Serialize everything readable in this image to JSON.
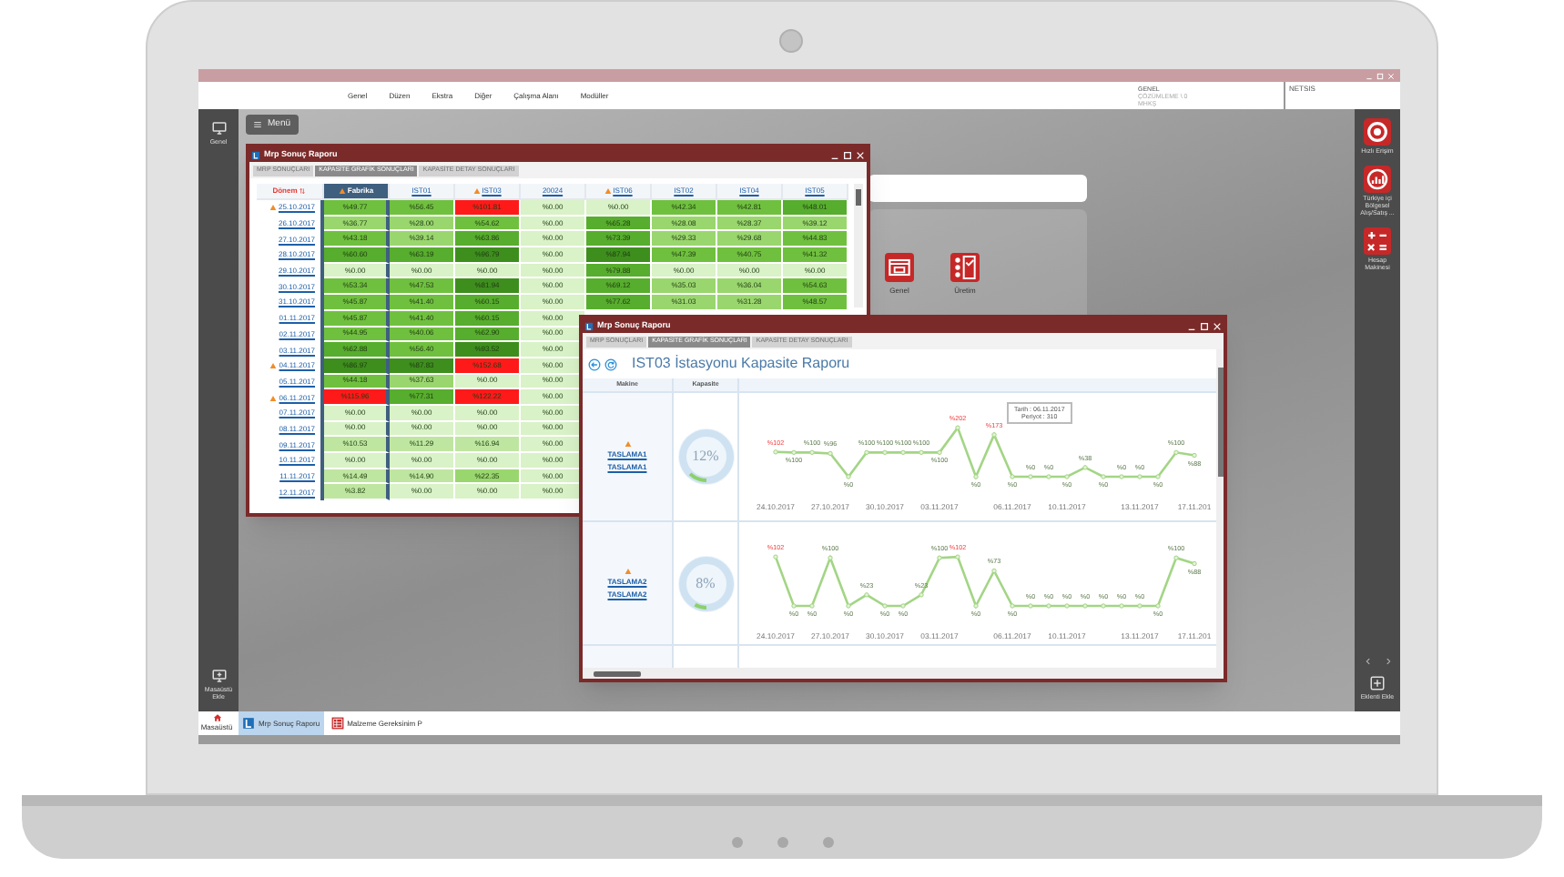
{
  "top_menu": {
    "items": [
      "Genel",
      "Düzen",
      "Ekstra",
      "Diğer",
      "Çalışma Alanı",
      "Modüller"
    ],
    "context": [
      "GENEL",
      "ÇÖZÜMLEME \\ 0",
      "MHKŞ"
    ],
    "product": "NETSIS"
  },
  "left_sidebar": {
    "top": "Genel",
    "bottom": "Masaüstü Ekle"
  },
  "right_sidebar": {
    "items": [
      {
        "kind": "target",
        "label": "Hızlı Erişim"
      },
      {
        "kind": "chart",
        "label": "Türkiye içi Bölgesel Alış/Satış ..."
      },
      {
        "kind": "calculator",
        "label": "Hesap Makinesi"
      }
    ],
    "add": "Eklenti Ekle"
  },
  "desktop": {
    "menu_button": "Menü",
    "shortcuts": [
      {
        "kind": "window",
        "label": "Genel"
      },
      {
        "kind": "checklist",
        "label": "Üretim"
      }
    ]
  },
  "report_window": {
    "title": "Mrp Sonuç Raporu",
    "tabs": [
      {
        "label": "MRP SONUÇLARI",
        "selected": false
      },
      {
        "label": "KAPASİTE GRAFİK SONUÇLARI",
        "selected": true
      },
      {
        "label": "KAPASİTE DETAY SONUÇLARI",
        "selected": false
      }
    ],
    "columns": [
      {
        "label": "Dönem",
        "sorted": true,
        "selected": false,
        "warning": false
      },
      {
        "label": "Fabrika",
        "sorted": false,
        "selected": true,
        "warning": true
      },
      {
        "label": "IST01",
        "sorted": false,
        "selected": false,
        "warning": false
      },
      {
        "label": "IST03",
        "sorted": false,
        "selected": false,
        "warning": true
      },
      {
        "label": "20024",
        "sorted": false,
        "selected": false,
        "warning": false
      },
      {
        "label": "IST06",
        "sorted": false,
        "selected": false,
        "warning": true
      },
      {
        "label": "IST02",
        "sorted": false,
        "selected": false,
        "warning": false
      },
      {
        "label": "IST04",
        "sorted": false,
        "selected": false,
        "warning": false
      },
      {
        "label": "IST05",
        "sorted": false,
        "selected": false,
        "warning": false
      }
    ],
    "rows": [
      {
        "warning": true,
        "cells": [
          {
            "text": "25.10.2017"
          },
          {
            "text": "%49.77",
            "color": "#70c03f"
          },
          {
            "text": "%56.45",
            "color": "#70c03f"
          },
          {
            "text": "%101.81",
            "color": "#ff1a1a"
          },
          {
            "text": "%0.00",
            "color": "#d9f2c7"
          },
          {
            "text": "%0.00",
            "color": "#d9f2c7"
          },
          {
            "text": "%42.34",
            "color": "#70c03f"
          },
          {
            "text": "%42.81",
            "color": "#70c03f"
          },
          {
            "text": "%48.01",
            "color": "#57ad2d"
          }
        ]
      },
      {
        "warning": false,
        "cells": [
          {
            "text": "26.10.2017"
          },
          {
            "text": "%36.77",
            "color": "#9ad66e"
          },
          {
            "text": "%28.00",
            "color": "#9ad66e"
          },
          {
            "text": "%54.62",
            "color": "#70c03f"
          },
          {
            "text": "%0.00",
            "color": "#d9f2c7"
          },
          {
            "text": "%65.28",
            "color": "#57ad2d"
          },
          {
            "text": "%28.08",
            "color": "#9ad66e"
          },
          {
            "text": "%28.37",
            "color": "#9ad66e"
          },
          {
            "text": "%39.12",
            "color": "#9ad66e"
          }
        ]
      },
      {
        "warning": false,
        "cells": [
          {
            "text": "27.10.2017"
          },
          {
            "text": "%43.18",
            "color": "#70c03f"
          },
          {
            "text": "%39.14",
            "color": "#9ad66e"
          },
          {
            "text": "%63.86",
            "color": "#57ad2d"
          },
          {
            "text": "%0.00",
            "color": "#d9f2c7"
          },
          {
            "text": "%73.39",
            "color": "#57ad2d"
          },
          {
            "text": "%29.33",
            "color": "#9ad66e"
          },
          {
            "text": "%29.68",
            "color": "#9ad66e"
          },
          {
            "text": "%44.83",
            "color": "#70c03f"
          }
        ]
      },
      {
        "warning": false,
        "cells": [
          {
            "text": "28.10.2017"
          },
          {
            "text": "%60.60",
            "color": "#57ad2d"
          },
          {
            "text": "%63.19",
            "color": "#57ad2d"
          },
          {
            "text": "%96.79",
            "color": "#3e8e1e"
          },
          {
            "text": "%0.00",
            "color": "#d9f2c7"
          },
          {
            "text": "%87.94",
            "color": "#3e8e1e"
          },
          {
            "text": "%47.39",
            "color": "#70c03f"
          },
          {
            "text": "%40.75",
            "color": "#70c03f"
          },
          {
            "text": "%41.32",
            "color": "#70c03f"
          }
        ]
      },
      {
        "warning": false,
        "cells": [
          {
            "text": "29.10.2017"
          },
          {
            "text": "%0.00",
            "color": "#d9f2c7"
          },
          {
            "text": "%0.00",
            "color": "#d9f2c7"
          },
          {
            "text": "%0.00",
            "color": "#d9f2c7"
          },
          {
            "text": "%0.00",
            "color": "#d9f2c7"
          },
          {
            "text": "%79.88",
            "color": "#57ad2d"
          },
          {
            "text": "%0.00",
            "color": "#d9f2c7"
          },
          {
            "text": "%0.00",
            "color": "#d9f2c7"
          },
          {
            "text": "%0.00",
            "color": "#d9f2c7"
          }
        ]
      },
      {
        "warning": false,
        "cells": [
          {
            "text": "30.10.2017"
          },
          {
            "text": "%53.34",
            "color": "#70c03f"
          },
          {
            "text": "%47.53",
            "color": "#70c03f"
          },
          {
            "text": "%81.94",
            "color": "#3e8e1e"
          },
          {
            "text": "%0.00",
            "color": "#d9f2c7"
          },
          {
            "text": "%69.12",
            "color": "#57ad2d"
          },
          {
            "text": "%35.03",
            "color": "#9ad66e"
          },
          {
            "text": "%36.04",
            "color": "#9ad66e"
          },
          {
            "text": "%54.63",
            "color": "#70c03f"
          }
        ]
      },
      {
        "warning": false,
        "cells": [
          {
            "text": "31.10.2017"
          },
          {
            "text": "%45.87",
            "color": "#70c03f"
          },
          {
            "text": "%41.40",
            "color": "#70c03f"
          },
          {
            "text": "%60.15",
            "color": "#57ad2d"
          },
          {
            "text": "%0.00",
            "color": "#d9f2c7"
          },
          {
            "text": "%77.62",
            "color": "#57ad2d"
          },
          {
            "text": "%31.03",
            "color": "#9ad66e"
          },
          {
            "text": "%31.28",
            "color": "#9ad66e"
          },
          {
            "text": "%48.57",
            "color": "#70c03f"
          }
        ]
      },
      {
        "warning": false,
        "cells": [
          {
            "text": "01.11.2017"
          },
          {
            "text": "%45.87",
            "color": "#70c03f"
          },
          {
            "text": "%41.40",
            "color": "#70c03f"
          },
          {
            "text": "%60.15",
            "color": "#57ad2d"
          },
          {
            "text": "%0.00",
            "color": "#d9f2c7"
          }
        ]
      },
      {
        "warning": false,
        "cells": [
          {
            "text": "02.11.2017"
          },
          {
            "text": "%44.95",
            "color": "#70c03f"
          },
          {
            "text": "%40.06",
            "color": "#70c03f"
          },
          {
            "text": "%62.90",
            "color": "#57ad2d"
          },
          {
            "text": "%0.00",
            "color": "#d9f2c7"
          }
        ]
      },
      {
        "warning": false,
        "cells": [
          {
            "text": "03.11.2017"
          },
          {
            "text": "%62.88",
            "color": "#57ad2d"
          },
          {
            "text": "%56.40",
            "color": "#70c03f"
          },
          {
            "text": "%93.52",
            "color": "#3e8e1e"
          },
          {
            "text": "%0.00",
            "color": "#d9f2c7"
          }
        ]
      },
      {
        "warning": true,
        "cells": [
          {
            "text": "04.11.2017"
          },
          {
            "text": "%86.97",
            "color": "#3e8e1e"
          },
          {
            "text": "%87.83",
            "color": "#3e8e1e"
          },
          {
            "text": "%152.68",
            "color": "#ff1a1a"
          },
          {
            "text": "%0.00",
            "color": "#d9f2c7"
          }
        ]
      },
      {
        "warning": false,
        "cells": [
          {
            "text": "05.11.2017"
          },
          {
            "text": "%44.18",
            "color": "#70c03f"
          },
          {
            "text": "%37.63",
            "color": "#9ad66e"
          },
          {
            "text": "%0.00",
            "color": "#d9f2c7"
          },
          {
            "text": "%0.00",
            "color": "#d9f2c7"
          }
        ]
      },
      {
        "warning": true,
        "cells": [
          {
            "text": "06.11.2017"
          },
          {
            "text": "%115.96",
            "color": "#ff1a1a"
          },
          {
            "text": "%77.31",
            "color": "#57ad2d"
          },
          {
            "text": "%122.22",
            "color": "#ff1a1a"
          },
          {
            "text": "%0.00",
            "color": "#d9f2c7"
          }
        ]
      },
      {
        "warning": false,
        "cells": [
          {
            "text": "07.11.2017"
          },
          {
            "text": "%0.00",
            "color": "#d9f2c7"
          },
          {
            "text": "%0.00",
            "color": "#d9f2c7"
          },
          {
            "text": "%0.00",
            "color": "#d9f2c7"
          },
          {
            "text": "%0.00",
            "color": "#d9f2c7"
          }
        ]
      },
      {
        "warning": false,
        "cells": [
          {
            "text": "08.11.2017"
          },
          {
            "text": "%0.00",
            "color": "#d9f2c7"
          },
          {
            "text": "%0.00",
            "color": "#d9f2c7"
          },
          {
            "text": "%0.00",
            "color": "#d9f2c7"
          },
          {
            "text": "%0.00",
            "color": "#d9f2c7"
          }
        ]
      },
      {
        "warning": false,
        "cells": [
          {
            "text": "09.11.2017"
          },
          {
            "text": "%10.53",
            "color": "#bfe6a0"
          },
          {
            "text": "%11.29",
            "color": "#bfe6a0"
          },
          {
            "text": "%16.94",
            "color": "#bfe6a0"
          },
          {
            "text": "%0.00",
            "color": "#d9f2c7"
          }
        ]
      },
      {
        "warning": false,
        "cells": [
          {
            "text": "10.11.2017"
          },
          {
            "text": "%0.00",
            "color": "#d9f2c7"
          },
          {
            "text": "%0.00",
            "color": "#d9f2c7"
          },
          {
            "text": "%0.00",
            "color": "#d9f2c7"
          },
          {
            "text": "%0.00",
            "color": "#d9f2c7"
          }
        ]
      },
      {
        "warning": false,
        "cells": [
          {
            "text": "11.11.2017"
          },
          {
            "text": "%14.49",
            "color": "#bfe6a0"
          },
          {
            "text": "%14.90",
            "color": "#bfe6a0"
          },
          {
            "text": "%22.35",
            "color": "#9ad66e"
          },
          {
            "text": "%0.00",
            "color": "#d9f2c7"
          }
        ]
      },
      {
        "warning": false,
        "cells": [
          {
            "text": "12.11.2017"
          },
          {
            "text": "%3.82",
            "color": "#bfe6a0"
          },
          {
            "text": "%0.00",
            "color": "#d9f2c7"
          },
          {
            "text": "%0.00",
            "color": "#d9f2c7"
          },
          {
            "text": "%0.00",
            "color": "#d9f2c7"
          }
        ]
      }
    ]
  },
  "capacity_window": {
    "title": "Mrp Sonuç Raporu",
    "tabs": [
      {
        "label": "MRP SONUÇLARI",
        "selected": false
      },
      {
        "label": "KAPASİTE GRAFİK SONUÇLARI",
        "selected": true
      },
      {
        "label": "KAPASİTE DETAY SONUÇLARI",
        "selected": false
      }
    ],
    "heading": "IST03 İstasyonu Kapasite Raporu",
    "columns": [
      "Makine",
      "Kapasite"
    ],
    "rows": [
      {
        "machine": [
          "TASLAMA1",
          "TASLAMA1"
        ],
        "warning": true,
        "capacity": {
          "text": "12%",
          "level": 0.12
        },
        "tooltip": [
          "Tarih : 06.11.2017",
          "Periyot : 310"
        ],
        "chart_label_prefix": "%",
        "chart_data": {
          "type": "line",
          "data_labels": true,
          "categories": [
            "24.10.2017",
            null,
            null,
            "27.10.2017",
            null,
            null,
            "30.10.2017",
            null,
            null,
            "03.11.2017",
            null,
            null,
            null,
            "06.11.2017",
            null,
            null,
            "10.11.2017",
            null,
            null,
            null,
            "13.11.2017",
            null,
            null,
            "17.11.201"
          ],
          "series": [
            {
              "color": "#a3d585",
              "marker": "circle",
              "values": [
                102,
                100,
                100,
                96,
                0,
                100,
                100,
                100,
                100,
                100,
                202,
                0,
                173,
                0,
                0,
                0,
                0,
                38,
                0,
                0,
                0,
                0,
                100,
                88
              ]
            }
          ]
        }
      },
      {
        "machine": [
          "TASLAMA2",
          "TASLAMA2"
        ],
        "warning": true,
        "capacity": {
          "text": "8%",
          "level": 0.08
        },
        "chart_label_prefix": "%",
        "chart_data": {
          "type": "line",
          "data_labels": true,
          "categories": [
            "24.10.2017",
            null,
            null,
            "27.10.2017",
            null,
            null,
            "30.10.2017",
            null,
            null,
            "03.11.2017",
            null,
            null,
            null,
            "06.11.2017",
            null,
            null,
            "10.11.2017",
            null,
            null,
            null,
            "13.11.2017",
            null,
            null,
            "17.11.201"
          ],
          "series": [
            {
              "color": "#a3d585",
              "marker": "circle",
              "values": [
                102,
                0,
                0,
                100,
                0,
                23,
                0,
                0,
                23,
                100,
                102,
                0,
                73,
                0,
                0,
                0,
                0,
                0,
                0,
                0,
                0,
                0,
                100,
                88
              ]
            }
          ]
        }
      }
    ]
  },
  "taskbar": [
    {
      "kind": "home",
      "label": "Masaüstü",
      "selected": false
    },
    {
      "kind": "report",
      "label": "Mrp Sonuç Raporu",
      "selected": true
    },
    {
      "kind": "grid",
      "label": "Malzeme Gereksinim P",
      "selected": false
    }
  ]
}
